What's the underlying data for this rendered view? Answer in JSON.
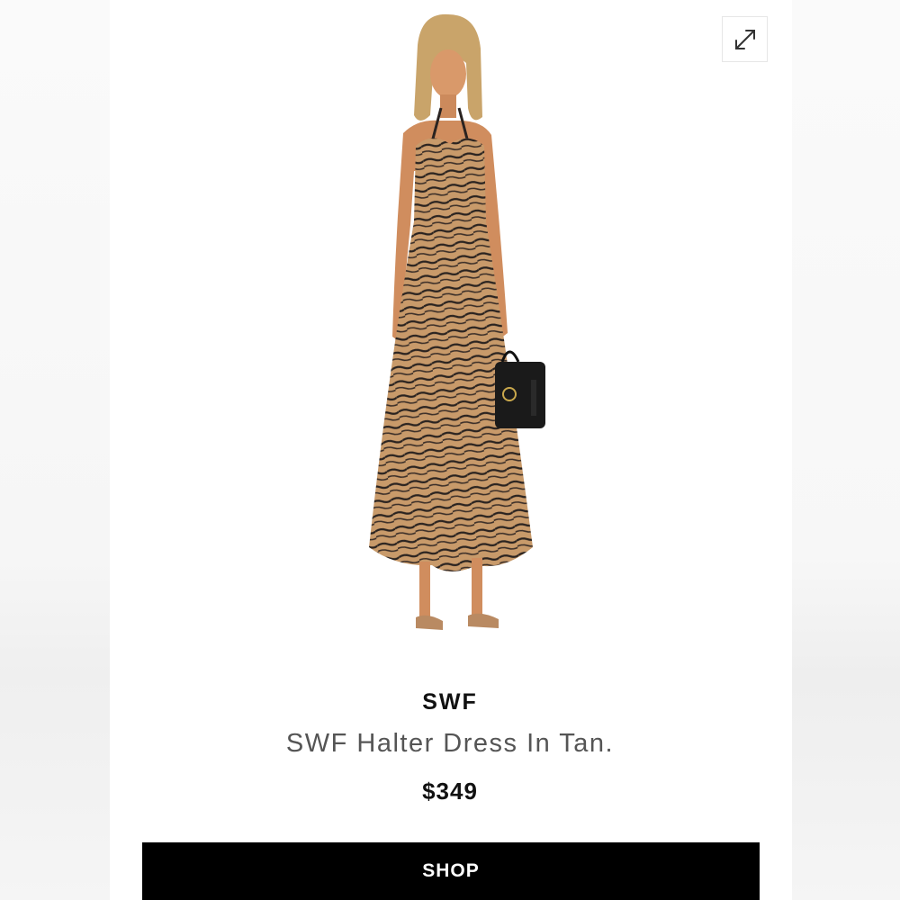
{
  "product": {
    "brand": "SWF",
    "name": "SWF Halter Dress In Tan.",
    "price": "$349",
    "image_alt": "Model wearing tan zebra-print halter maxi dress holding black handbag"
  },
  "actions": {
    "shop_label": "SHOP",
    "expand_icon": "expand-icon"
  },
  "colors": {
    "dress_tan": "#c89a6a",
    "stripe": "#2a2320",
    "button_bg": "#000000",
    "button_text": "#ffffff"
  }
}
